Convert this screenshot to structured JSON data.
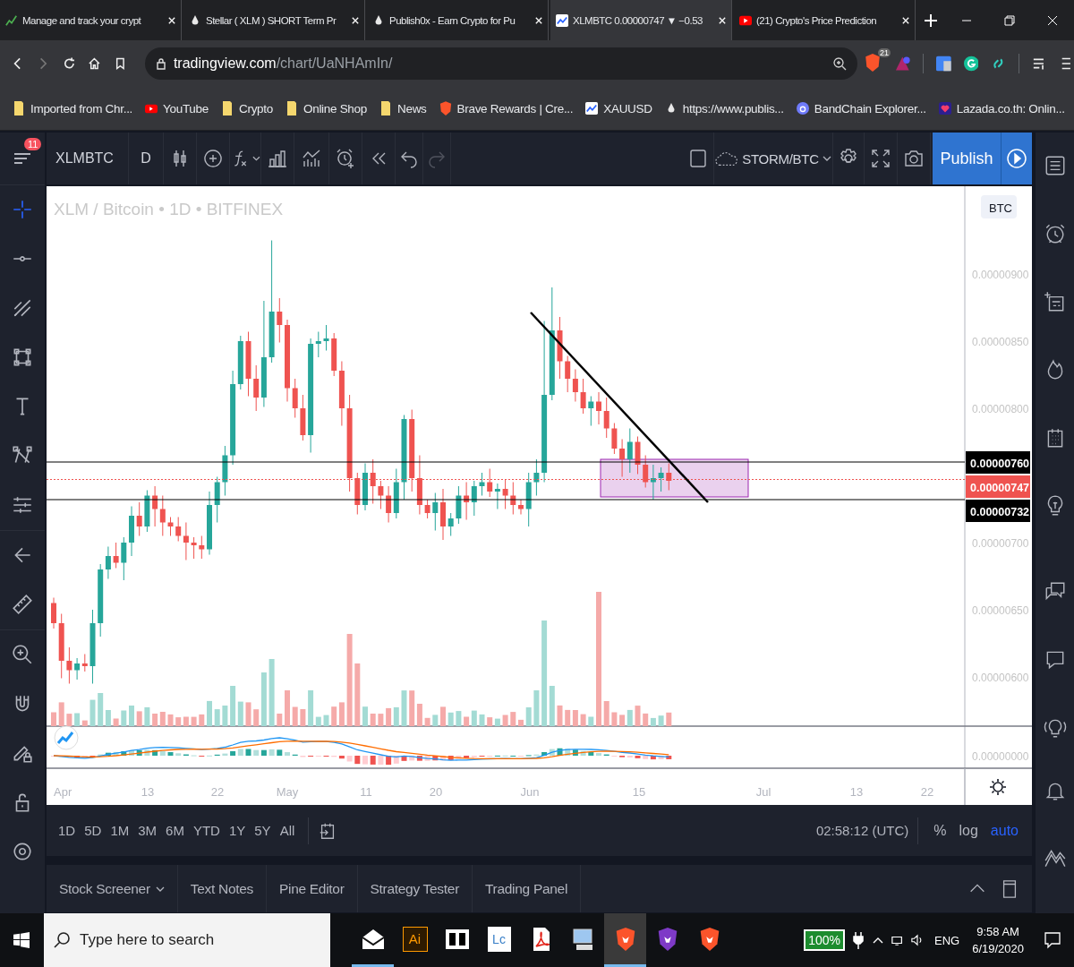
{
  "browser": {
    "tabs": [
      {
        "title": "Manage and track your crypt",
        "kind": "chart",
        "selected": false
      },
      {
        "title": "Stellar ( XLM ) SHORT Term Pr",
        "kind": "drop",
        "selected": false
      },
      {
        "title": "Publish0x - Earn Crypto for Pu",
        "kind": "drop",
        "selected": false
      },
      {
        "title": "XLMBTC 0.00000747 ▼ −0.53",
        "kind": "tv",
        "selected": true
      },
      {
        "title": "(21) Crypto's Price Prediction",
        "kind": "youtube",
        "selected": false
      }
    ],
    "address": {
      "host": "tradingview.com",
      "path": "/chart/UaNHAmIn/"
    },
    "shields_count": "21",
    "bookmarks": [
      {
        "label": "Imported from Chr...",
        "kind": "folder"
      },
      {
        "label": "YouTube",
        "kind": "youtube"
      },
      {
        "label": "Crypto",
        "kind": "folder"
      },
      {
        "label": "Online Shop",
        "kind": "folder"
      },
      {
        "label": "News",
        "kind": "folder"
      },
      {
        "label": "Brave Rewards | Cre...",
        "kind": "brave"
      },
      {
        "label": "XAUUSD",
        "kind": "tv"
      },
      {
        "label": "https://www.publis...",
        "kind": "drop"
      },
      {
        "label": "BandChain Explorer...",
        "kind": "band"
      },
      {
        "label": "Lazada.co.th: Onlin...",
        "kind": "lazada"
      }
    ]
  },
  "chart_toolbar": {
    "notifications": "11",
    "symbol": "XLMBTC",
    "interval": "D",
    "layout_name": "STORM/BTC",
    "publish": "Publish"
  },
  "chart": {
    "title": "XLM / Bitcoin • 1D • BITFINEX",
    "currency": "BTC",
    "price_ticks": [
      "0.00000900",
      "0.00000850",
      "0.00000800",
      "0.00000700",
      "0.00000650",
      "0.00000600"
    ],
    "macd_tick": "0.00000000",
    "price_labels": [
      {
        "text": "0.00000760",
        "kind": "level"
      },
      {
        "text": "0.00000747",
        "kind": "last"
      },
      {
        "text": "0.00000732",
        "kind": "level"
      }
    ],
    "time_ticks": [
      "Apr",
      "13",
      "22",
      "May",
      "11",
      "20",
      "Jun",
      "15",
      "Jul",
      "13",
      "22"
    ]
  },
  "range_bar": {
    "ranges": [
      "1D",
      "5D",
      "1M",
      "3M",
      "6M",
      "YTD",
      "1Y",
      "5Y",
      "All"
    ],
    "clock": "02:58:12 (UTC)",
    "scale_options": [
      {
        "label": "%",
        "selected": false
      },
      {
        "label": "log",
        "selected": false
      },
      {
        "label": "auto",
        "selected": true
      }
    ]
  },
  "bottom_panel": {
    "tabs": [
      "Stock Screener",
      "Text Notes",
      "Pine Editor",
      "Strategy Tester",
      "Trading Panel"
    ]
  },
  "taskbar": {
    "search_placeholder": "Type here to search",
    "apps": [
      {
        "kind": "mail",
        "running": true,
        "selected": false
      },
      {
        "kind": "illustrator",
        "label": "Ai",
        "running": false,
        "selected": false
      },
      {
        "kind": "dolby",
        "running": false,
        "selected": false
      },
      {
        "kind": "lc",
        "label": "Lc",
        "running": false,
        "selected": false
      },
      {
        "kind": "pdf",
        "running": false,
        "selected": false
      },
      {
        "kind": "computer",
        "running": false,
        "selected": false
      },
      {
        "kind": "brave",
        "running": true,
        "selected": true
      },
      {
        "kind": "brave-purple",
        "running": false,
        "selected": false
      },
      {
        "kind": "brave",
        "running": false,
        "selected": false
      }
    ],
    "battery": "100%",
    "language": "ENG",
    "time": "9:58 AM",
    "date": "6/19/2020"
  }
}
